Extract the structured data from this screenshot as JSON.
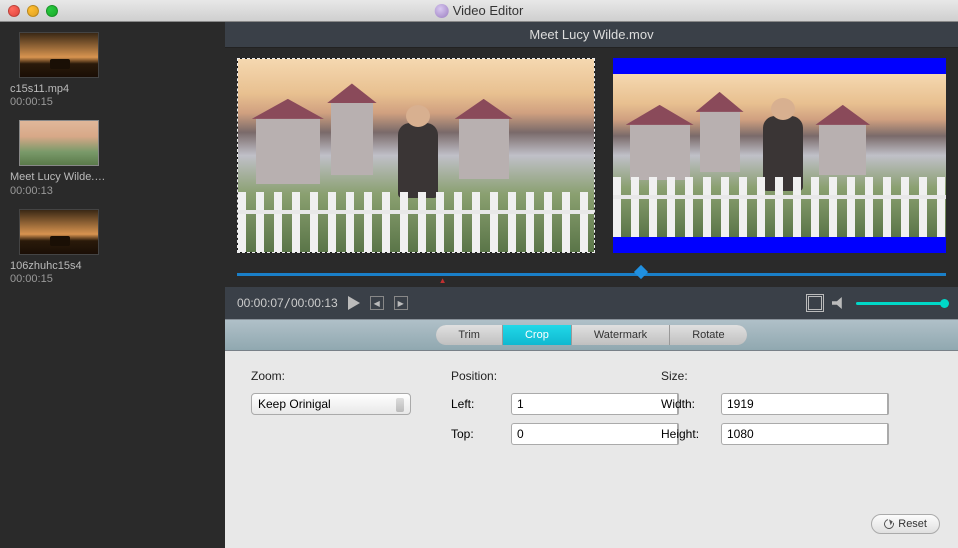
{
  "app": {
    "title": "Video Editor"
  },
  "current_file": "Meet Lucy Wilde.mov",
  "clips": [
    {
      "name": "c15s11.mp4",
      "duration": "00:00:15"
    },
    {
      "name": "Meet Lucy Wilde.mov",
      "duration": "00:00:13"
    },
    {
      "name": "106zhuhc15s4",
      "duration": "00:00:15"
    }
  ],
  "playback": {
    "current": "00:00:07",
    "total": "00:00:13",
    "playhead_percent": 57,
    "scrub_percent": 29
  },
  "tabs": [
    "Trim",
    "Crop",
    "Watermark",
    "Rotate"
  ],
  "active_tab": "Crop",
  "crop": {
    "zoom_label": "Zoom:",
    "zoom_value": "Keep Orinigal",
    "position_label": "Position:",
    "left_label": "Left:",
    "left_value": "1",
    "top_label": "Top:",
    "top_value": "0",
    "size_label": "Size:",
    "width_label": "Width:",
    "width_value": "1919",
    "height_label": "Height:",
    "height_value": "1080",
    "reset_label": "Reset"
  }
}
